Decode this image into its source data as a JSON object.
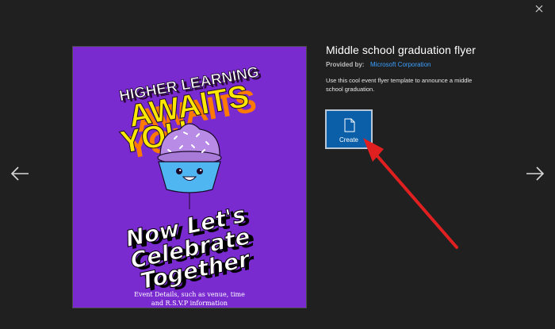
{
  "dialog": {
    "title": "Middle school graduation flyer",
    "provided_by_label": "Provided by:",
    "provider": "Microsoft Corporation",
    "description": "Use this cool event flyer template to announce a middle school graduation.",
    "create_label": "Create"
  },
  "flyer": {
    "headline_1": "HIGHER LEARNING",
    "headline_2": "AWAITS",
    "headline_3": "YOU",
    "tagline_1": "Now Let's",
    "tagline_2": "Celebrate",
    "tagline_3": "Together",
    "details_line_1": "Event Details, such as venue, time",
    "details_line_2": "and R.S.V.P information"
  },
  "colors": {
    "background": "#202020",
    "flyer_purple": "#7a2bd0",
    "create_blue": "#0b5fa8",
    "link_blue": "#3aa0ff",
    "arrow_red": "#e02020"
  },
  "icons": {
    "close": "close-icon",
    "prev": "arrow-left-icon",
    "next": "arrow-right-icon",
    "create": "document-icon"
  }
}
